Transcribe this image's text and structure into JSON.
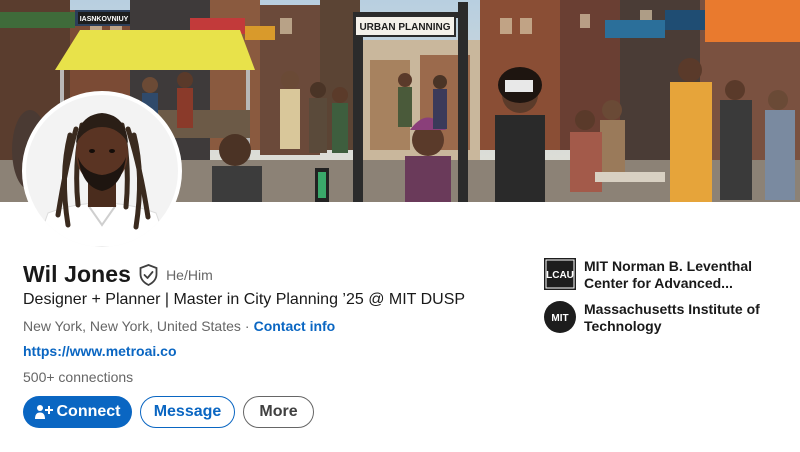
{
  "banner": {
    "sign_text": "URBAN PLANNING",
    "shop_sign_text": "IASNKOVNIUY"
  },
  "profile": {
    "name": "Wil Jones",
    "pronouns": "He/Him",
    "headline": "Designer + Planner | Master in City Planning ’25 @ MIT DUSP",
    "location": "New York, New York, United States",
    "separator": "·",
    "contact_info_label": "Contact info",
    "website": "https://www.metroai.co",
    "connections": "500+ connections"
  },
  "actions": {
    "connect_label": "Connect",
    "message_label": "Message",
    "more_label": "More"
  },
  "orgs": [
    {
      "logo_text": "LCAU",
      "name_line1": "MIT Norman B. Leventhal",
      "name_line2": "Center for Advanced..."
    },
    {
      "logo_text": "MIT",
      "name_line1": "Massachusetts Institute of",
      "name_line2": "Technology"
    }
  ],
  "colors": {
    "accent": "#0a66c2",
    "text_primary": "#191919",
    "text_secondary": "#666666"
  },
  "icons": {
    "verified": "shield-check-icon",
    "connect": "add-person-icon"
  }
}
